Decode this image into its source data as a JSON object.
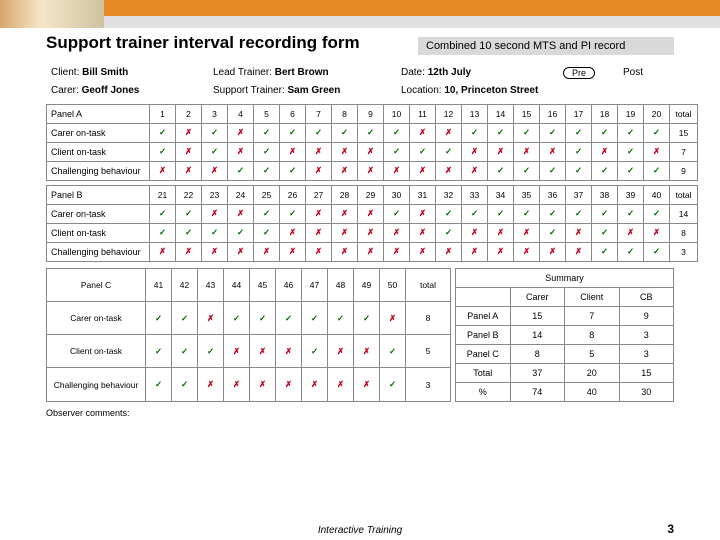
{
  "header": {
    "title": "Support trainer interval recording form",
    "combined": "Combined 10 second MTS and PI record"
  },
  "meta": {
    "client_lbl": "Client:",
    "client_val": "Bill Smith",
    "lead_lbl": "Lead Trainer:",
    "lead_val": "Bert Brown",
    "date_lbl": "Date:",
    "date_val": "12th July",
    "pre": "Pre",
    "post": "Post",
    "carer_lbl": "Carer:",
    "carer_val": "Geoff Jones",
    "support_lbl": "Support Trainer:",
    "support_val": "Sam Green",
    "loc_lbl": "Location:",
    "loc_val": "10, Princeton Street"
  },
  "rows": {
    "carer": "Carer on-task",
    "client": "Client on-task",
    "chal": "Challenging behaviour",
    "obs": "Observer comments:",
    "total": "total"
  },
  "panelA": {
    "name": "Panel A",
    "nums": [
      "1",
      "2",
      "3",
      "4",
      "5",
      "6",
      "7",
      "8",
      "9",
      "10",
      "11",
      "12",
      "13",
      "14",
      "15",
      "16",
      "17",
      "18",
      "19",
      "20"
    ],
    "carer": [
      "t",
      "x",
      "t",
      "x",
      "t",
      "t",
      "t",
      "t",
      "t",
      "t",
      "x",
      "x",
      "t",
      "t",
      "t",
      "t",
      "t",
      "t",
      "t",
      "t"
    ],
    "client": [
      "t",
      "x",
      "t",
      "x",
      "t",
      "x",
      "x",
      "x",
      "x",
      "t",
      "t",
      "t",
      "x",
      "x",
      "x",
      "x",
      "t",
      "x",
      "t",
      "x"
    ],
    "chal": [
      "x",
      "x",
      "x",
      "t",
      "t",
      "t",
      "x",
      "x",
      "x",
      "x",
      "x",
      "x",
      "x",
      "t",
      "t",
      "t",
      "t",
      "t",
      "t",
      "t"
    ],
    "tot": {
      "carer": "15",
      "client": "7",
      "chal": "9"
    }
  },
  "panelB": {
    "name": "Panel B",
    "nums": [
      "21",
      "22",
      "23",
      "24",
      "25",
      "26",
      "27",
      "28",
      "29",
      "30",
      "31",
      "32",
      "33",
      "34",
      "35",
      "36",
      "37",
      "38",
      "39",
      "40"
    ],
    "carer": [
      "t",
      "t",
      "x",
      "x",
      "t",
      "t",
      "x",
      "x",
      "x",
      "t",
      "x",
      "t",
      "t",
      "t",
      "t",
      "t",
      "t",
      "t",
      "t",
      "t"
    ],
    "client": [
      "t",
      "t",
      "t",
      "t",
      "t",
      "x",
      "x",
      "x",
      "x",
      "x",
      "x",
      "t",
      "x",
      "x",
      "x",
      "t",
      "x",
      "t",
      "x",
      "x"
    ],
    "chal": [
      "x",
      "x",
      "x",
      "x",
      "x",
      "x",
      "x",
      "x",
      "x",
      "x",
      "x",
      "x",
      "x",
      "x",
      "x",
      "x",
      "x",
      "t",
      "t",
      "t"
    ],
    "tot": {
      "carer": "14",
      "client": "8",
      "chal": "3"
    }
  },
  "panelC": {
    "name": "Panel C",
    "nums": [
      "41",
      "42",
      "43",
      "44",
      "45",
      "46",
      "47",
      "48",
      "49",
      "50"
    ],
    "carer": [
      "t",
      "t",
      "x",
      "t",
      "t",
      "t",
      "t",
      "t",
      "t",
      "x"
    ],
    "client": [
      "t",
      "t",
      "t",
      "x",
      "x",
      "x",
      "t",
      "x",
      "x",
      "t"
    ],
    "chal": [
      "t",
      "t",
      "x",
      "x",
      "x",
      "x",
      "x",
      "x",
      "x",
      "t"
    ],
    "tot_lbl": "total",
    "tot": {
      "carer": "8",
      "client": "5",
      "chal": "3"
    }
  },
  "summary": {
    "title": "Summary",
    "hdr": [
      "",
      "Carer",
      "Client",
      "CB"
    ],
    "rows": [
      [
        "Panel A",
        "15",
        "7",
        "9"
      ],
      [
        "Panel B",
        "14",
        "8",
        "3"
      ],
      [
        "Panel C",
        "8",
        "5",
        "3"
      ],
      [
        "Total",
        "37",
        "20",
        "15"
      ],
      [
        "%",
        "74",
        "40",
        "30"
      ]
    ]
  },
  "footer": {
    "text": "Interactive Training",
    "page": "3"
  }
}
